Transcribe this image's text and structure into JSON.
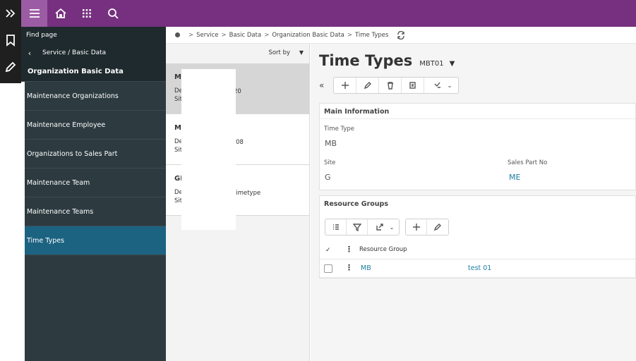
{
  "topbar": {
    "icons": [
      "menu-icon",
      "home-icon",
      "apps-grid-icon",
      "search-icon"
    ],
    "accent": "#76307f"
  },
  "rail": {
    "icons": [
      "expand-icon",
      "bookmark-icon",
      "pencil-icon"
    ]
  },
  "navigator": {
    "find_page": "Find page",
    "crumb": "Service / Basic Data",
    "group": "Organization Basic Data",
    "items": [
      {
        "label": "Maintenance Organizations"
      },
      {
        "label": "Maintenance Employee"
      },
      {
        "label": "Organizations to Sales Part"
      },
      {
        "label": "Maintenance Team"
      },
      {
        "label": "Maintenance Teams"
      },
      {
        "label": "Time Types"
      }
    ],
    "selected_color": "#1c6281"
  },
  "breadcrumb": {
    "items": [
      "Service",
      "Basic Data",
      "Organization Basic Data",
      "Time Types"
    ]
  },
  "list": {
    "sort_label": "Sort by",
    "cards": [
      {
        "title": "M",
        "line1": "De",
        "line2": "Sit",
        "value": "20"
      },
      {
        "title": "M",
        "line1": "De",
        "line2": "Sit",
        "value": "-08"
      },
      {
        "title": "GI",
        "line1": "De",
        "line2": "Sit",
        "value": "timetype"
      }
    ]
  },
  "detail": {
    "title": "Time Types",
    "key": "MBT01",
    "main_info": {
      "header": "Main Information",
      "time_type_label": "Time Type",
      "time_type_value": "MB",
      "site_label": "Site",
      "site_value": "G",
      "sales_part_label": "Sales Part No",
      "sales_part_value": "ME"
    },
    "resource_groups": {
      "header": "Resource Groups",
      "column": "Resource Group",
      "rows": [
        {
          "group": "MB",
          "desc": "test 01"
        }
      ]
    }
  }
}
